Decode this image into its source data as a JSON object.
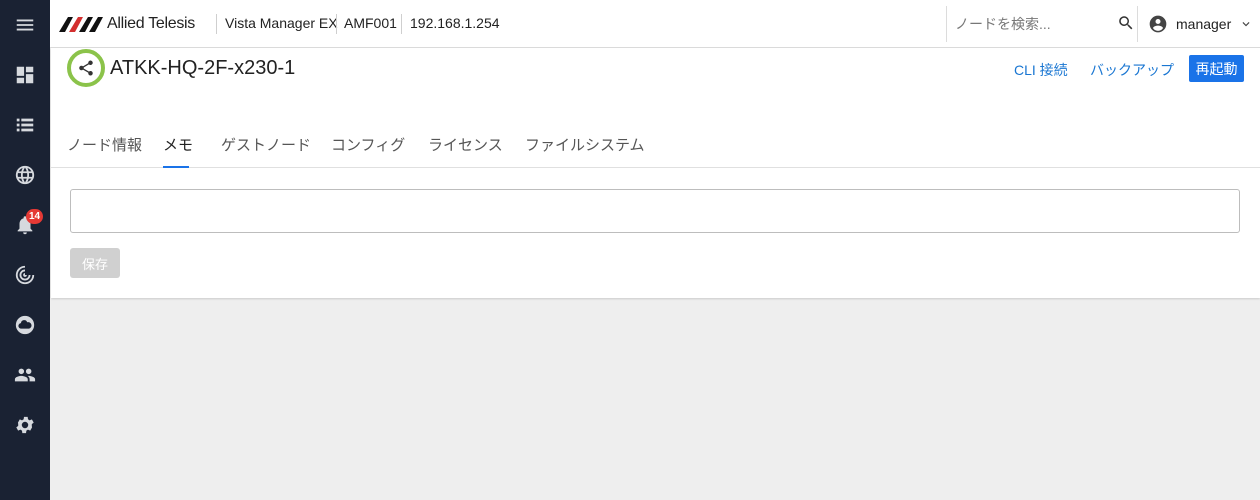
{
  "sidebar": {
    "items": [
      {
        "name": "menu-icon"
      },
      {
        "name": "dashboard-icon"
      },
      {
        "name": "list-icon"
      },
      {
        "name": "globe-icon"
      },
      {
        "name": "bell-icon",
        "badge": "14"
      },
      {
        "name": "radar-icon"
      },
      {
        "name": "cloud-icon"
      },
      {
        "name": "users-icon"
      },
      {
        "name": "gear-icon"
      }
    ]
  },
  "topbar": {
    "brand": "Allied Telesis",
    "product": "Vista Manager EX",
    "area": "AMF001",
    "ip": "192.168.1.254",
    "search_placeholder": "ノードを検索...",
    "user": "manager"
  },
  "header": {
    "node_name": "ATKK-HQ-2F-x230-1",
    "cli_label": "CLI 接続",
    "backup_label": "バックアップ",
    "reboot_label": "再起動"
  },
  "tabs": [
    {
      "label": "ノード情報"
    },
    {
      "label": "メモ",
      "active": true
    },
    {
      "label": "ゲストノード"
    },
    {
      "label": "コンフィグ"
    },
    {
      "label": "ライセンス"
    },
    {
      "label": "ファイルシステム"
    }
  ],
  "memo": {
    "value": "",
    "save_label": "保存"
  },
  "colors": {
    "rail": "#1a2233",
    "accent": "#1a73e8",
    "node_ring": "#8bc34a",
    "badge": "#e53935"
  }
}
